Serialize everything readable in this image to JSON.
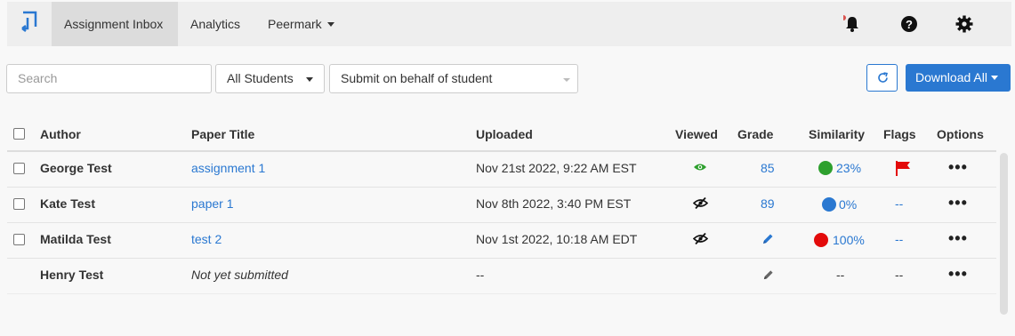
{
  "nav": {
    "tabs": [
      {
        "label": "Assignment Inbox",
        "active": true
      },
      {
        "label": "Analytics",
        "active": false
      },
      {
        "label": "Peermark",
        "active": false
      }
    ],
    "icons": [
      "bell-icon",
      "help-icon",
      "gear-icon"
    ]
  },
  "toolbar": {
    "search_placeholder": "Search",
    "students_filter": "All Students",
    "submit_behalf": "Submit on behalf of student",
    "download_label": "Download All"
  },
  "table": {
    "columns": [
      "Author",
      "Paper Title",
      "Uploaded",
      "Viewed",
      "Grade",
      "Similarity",
      "Flags",
      "Options"
    ],
    "rows": [
      {
        "author": "George Test",
        "title": "assignment 1",
        "uploaded": "Nov 21st 2022, 9:22 AM EST",
        "viewed": "eye-icon",
        "grade": "85",
        "similarity": "23%",
        "similarity_color": "#2ea02e",
        "flag": "red-flag-icon"
      },
      {
        "author": "Kate Test",
        "title": "paper 1",
        "uploaded": "Nov 8th 2022, 3:40 PM EST",
        "viewed": "eye-slash-icon",
        "grade": "89",
        "similarity": "0%",
        "similarity_color": "#2a78d1",
        "flag": "--"
      },
      {
        "author": "Matilda Test",
        "title": "test 2",
        "uploaded": "Nov 1st 2022, 10:18 AM EDT",
        "viewed": "eye-slash-icon",
        "grade": "pencil-icon",
        "similarity": "100%",
        "similarity_color": "#e30b0b",
        "flag": "--"
      },
      {
        "author": "Henry Test",
        "title": "Not yet submitted",
        "uploaded": "--",
        "viewed": "",
        "grade": "pencil-icon",
        "similarity": "--",
        "similarity_color": "",
        "flag": "--"
      }
    ],
    "options_glyph": "•••"
  },
  "colors": {
    "accent": "#2a78d1",
    "nav_bg": "#eeeeee",
    "flag_red": "#e30b0b",
    "notif_dot": "#d9534f"
  }
}
